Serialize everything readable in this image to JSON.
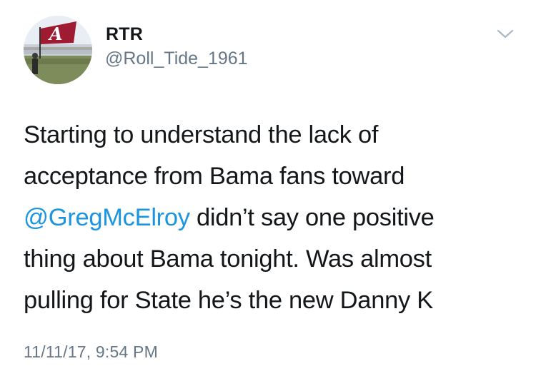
{
  "user": {
    "display_name": "RTR",
    "handle": "@Roll_Tide_1961"
  },
  "header": {
    "menu_icon": "chevron-down-icon",
    "avatar_icon": "alabama-script-a-flag-icon"
  },
  "tweet": {
    "line1": "Starting to understand the lack of",
    "line2": "acceptance from Bama fans toward",
    "mention": "@GregMcElroy",
    "line3_rest": " didn’t say one positive",
    "line4": "thing about Bama tonight. Was almost",
    "line5": "pulling for State he’s the new Danny K",
    "timestamp": "11/11/17, 9:54 PM"
  },
  "colors": {
    "mention": "#1b95e0",
    "secondary_text": "#657786",
    "primary_text": "#14171a",
    "flag_red": "#9e1b32"
  }
}
